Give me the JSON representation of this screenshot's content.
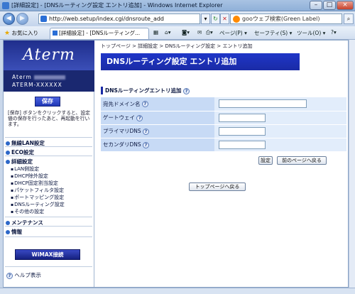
{
  "window": {
    "title": "[詳細設定] - [DNSルーティング設定 エントリ追加] - Windows Internet Explorer",
    "controls": [
      "–",
      "□",
      "×"
    ]
  },
  "address_bar": {
    "url": "http://web.setup/index.cgi/dnsroute_add",
    "search_placeholder": "gooウェブ検索(Green Label)"
  },
  "command_bar": {
    "favorites": "お気に入り",
    "tab_label": "[詳細設定] - [DNSルーティング...",
    "page_menu": "ページ(P) ▾",
    "safety_menu": "セーフティ(S) ▾",
    "tools_menu": "ツール(O) ▾",
    "help_menu": "?▾"
  },
  "sidebar": {
    "logo": "Aterm",
    "model_line1": "Aterm",
    "model_line2": "ATERM-XXXXXX",
    "save_label": "保存",
    "save_hint": "[保存] ボタンをクリックすると、設定値の保存を行ったあと、再起動を行います。",
    "menu": {
      "wireless": "無線LAN設定",
      "eco": "ECO設定",
      "advanced": "詳細設定",
      "maintenance": "メンテナンス",
      "info": "情報"
    },
    "submenu": [
      "LAN側設定",
      "DHCP除外設定",
      "DHCP固定割当設定",
      "パケットフィルタ設定",
      "ポートマッピング設定",
      "DNSルーティング設定",
      "その他の設定"
    ],
    "wimax_button": "WiMAX接続",
    "help": "ヘルプ表示"
  },
  "main": {
    "breadcrumb": "トップページ > 詳細設定 > DNSルーティング設定 > エントリ追加",
    "title": "DNSルーティング設定 エントリ追加",
    "section_title": "DNSルーティングエントリ追加",
    "fields": [
      {
        "label": "宛先ドメイン名",
        "value": ""
      },
      {
        "label": "ゲートウェイ",
        "value": ""
      },
      {
        "label": "プライマリDNS",
        "value": ""
      },
      {
        "label": "セカンダリDNS",
        "value": ""
      }
    ],
    "set_button": "設定",
    "back_button": "前のページへ戻る",
    "top_button": "トップページへ戻る"
  },
  "colors": {
    "title_bar_blue": "#1f36c8",
    "label_cell": "#c7daf5",
    "value_cell": "#e2edfb"
  }
}
